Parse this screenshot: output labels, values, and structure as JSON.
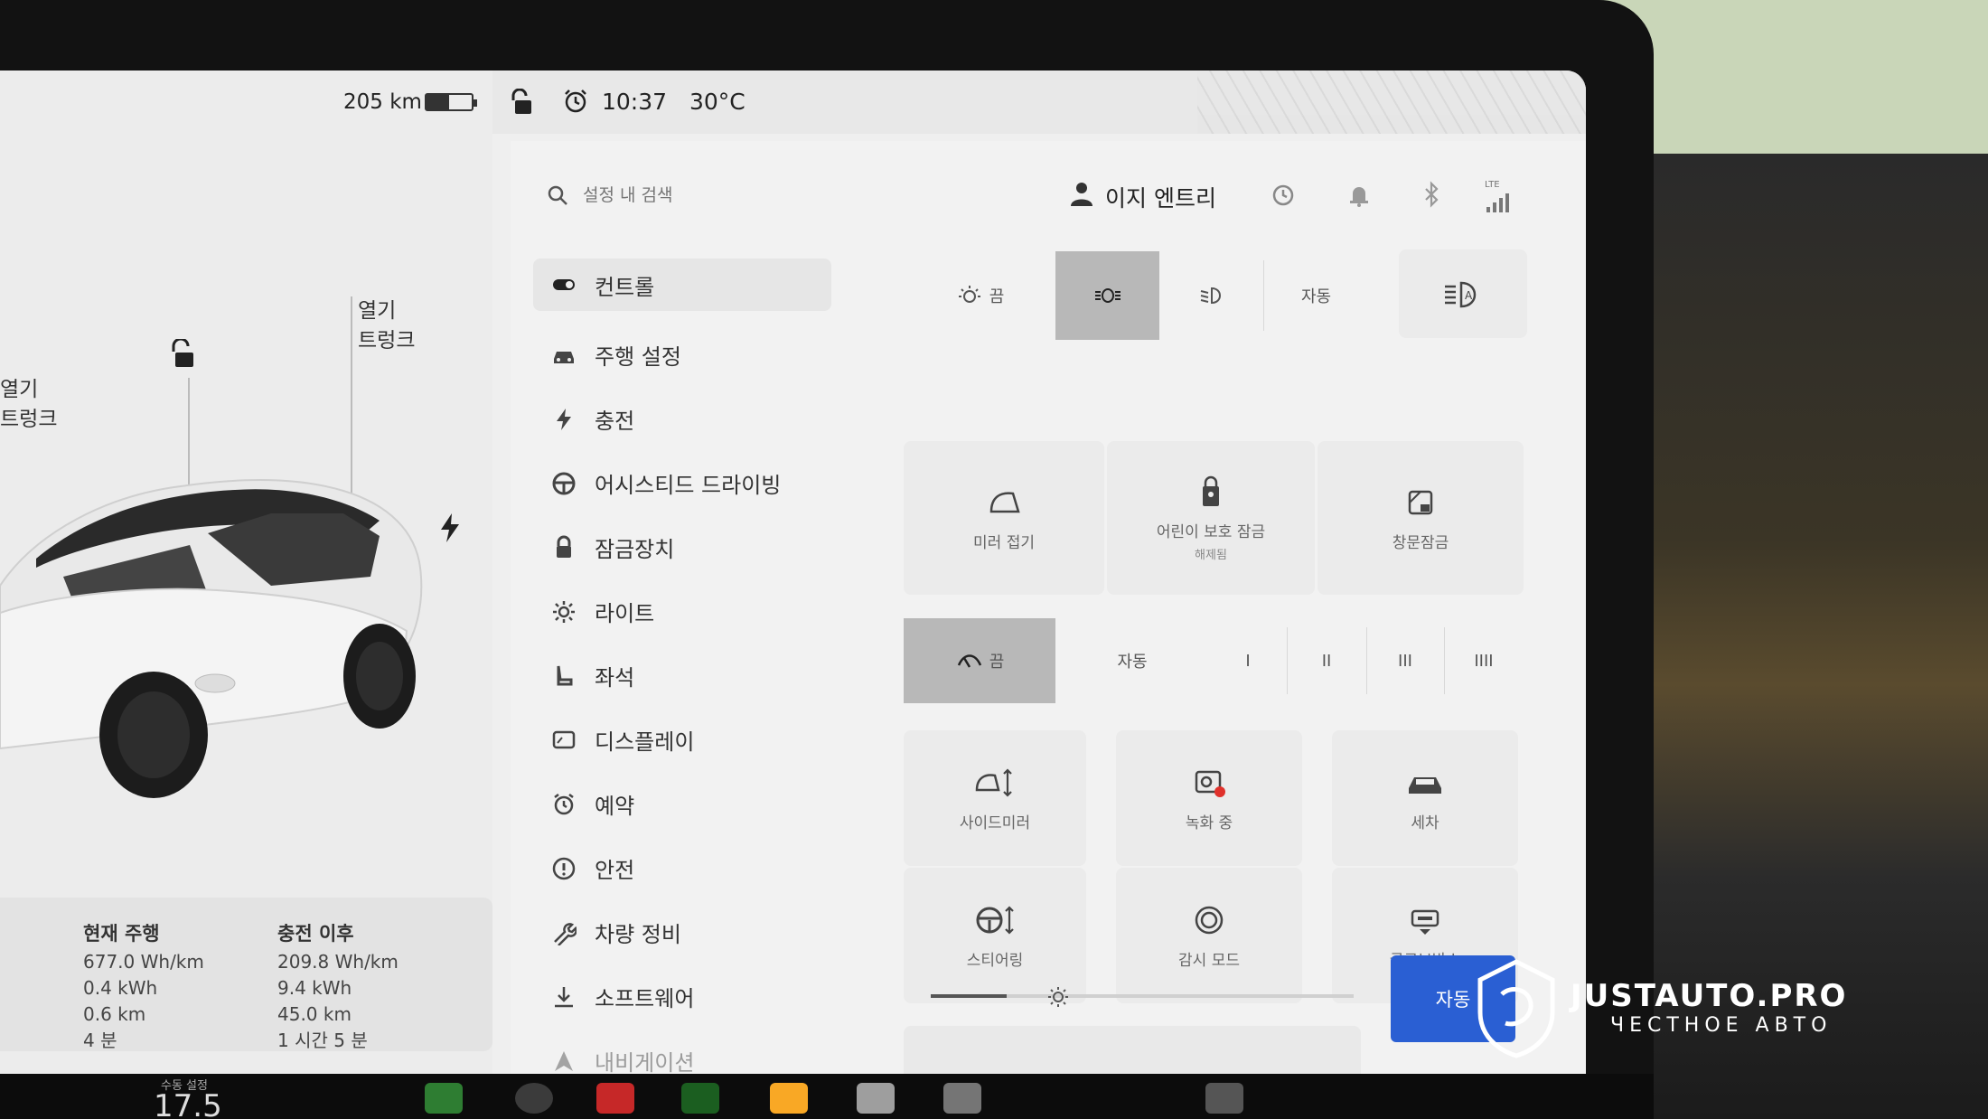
{
  "status": {
    "range": "205 km",
    "battery_level": 0.5,
    "time": "10:37",
    "temperature": "30°C"
  },
  "vehicle": {
    "rear_trunk": {
      "line1": "열기",
      "line2": "트렁크"
    },
    "front_trunk": {
      "line1": "열기",
      "line2": "트렁크"
    }
  },
  "trip": {
    "current": {
      "title": "현재 주행",
      "energy_rate": "677.0 Wh/km",
      "energy": "0.4 kWh",
      "distance": "0.6 km",
      "time": "4 분"
    },
    "since_charge": {
      "title": "충전 이후",
      "energy_rate": "209.8 Wh/km",
      "energy": "9.4 kWh",
      "distance": "45.0 km",
      "time": "1 시간 5 분"
    }
  },
  "header": {
    "search_placeholder": "설정 내 검색",
    "profile_label": "이지 엔트리",
    "network_label": "LTE"
  },
  "sidebar": {
    "items": [
      {
        "label": "컨트롤",
        "icon": "toggle-icon"
      },
      {
        "label": "주행 설정",
        "icon": "car-icon"
      },
      {
        "label": "충전",
        "icon": "bolt-icon"
      },
      {
        "label": "어시스티드 드라이빙",
        "icon": "steering-icon"
      },
      {
        "label": "잠금장치",
        "icon": "lock-icon"
      },
      {
        "label": "라이트",
        "icon": "sun-icon"
      },
      {
        "label": "좌석",
        "icon": "seat-icon"
      },
      {
        "label": "디스플레이",
        "icon": "display-icon"
      },
      {
        "label": "예약",
        "icon": "alarm-icon"
      },
      {
        "label": "안전",
        "icon": "info-icon"
      },
      {
        "label": "차량 정비",
        "icon": "wrench-icon"
      },
      {
        "label": "소프트웨어",
        "icon": "download-icon"
      },
      {
        "label": "내비게이션",
        "icon": "navigation-icon"
      }
    ]
  },
  "lights": {
    "off_label": "끔",
    "auto_label": "자동",
    "selected": "parking"
  },
  "quick_cards": {
    "fold_mirrors": "미러 접기",
    "child_lock": "어린이 보호 잠금",
    "child_lock_status": "해제됨",
    "window_lock": "창문잠금"
  },
  "wipers": {
    "off_label": "끔",
    "auto_label": "자동",
    "speeds": [
      "I",
      "II",
      "III",
      "IIII"
    ]
  },
  "controls_grid": {
    "side_mirrors": "사이드미러",
    "recording": "녹화 중",
    "car_wash": "세차",
    "steering": "스티어링",
    "sentry": "감시 모드",
    "glovebox": "글로브박스"
  },
  "brightness": {
    "level": 0.18,
    "auto_label": "자동"
  },
  "climate": {
    "label": "수동 설정",
    "temperature": "17.5"
  },
  "watermark": {
    "brand": "JUSTAUTO.PRO",
    "tagline": "ЧЕСТНОЕ АВТО"
  },
  "colors": {
    "accent_blue": "#2a5fd3",
    "selected_gray": "#b8b8b8",
    "recording_red": "#e0312b"
  }
}
